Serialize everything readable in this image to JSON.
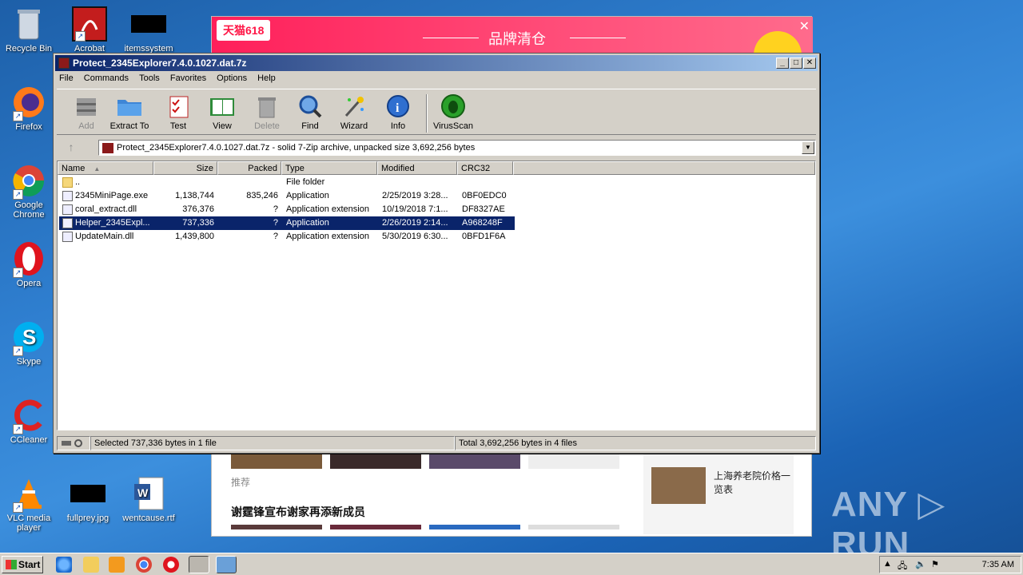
{
  "desktop": {
    "icons": [
      {
        "label": "Recycle Bin"
      },
      {
        "label": "Acrobat"
      },
      {
        "label": "itemssystem"
      },
      {
        "label": "Firefox"
      },
      {
        "label": "Google Chrome"
      },
      {
        "label": "Opera"
      },
      {
        "label": "Skype"
      },
      {
        "label": "CCleaner"
      },
      {
        "label": "VLC media player"
      },
      {
        "label": "fullprey.jpg"
      },
      {
        "label": "wentcause.rtf"
      }
    ]
  },
  "background_browser": {
    "banner_tag": "天猫618",
    "banner_title": "品牌清仓",
    "section_label": "推荐",
    "headline": "谢霆锋宣布谢家再添新成员",
    "side_news": "上海养老院价格一览表"
  },
  "window": {
    "title": "Protect_2345Explorer7.4.0.1027.dat.7z",
    "controls": {
      "minimize": "_",
      "maximize": "□",
      "close": "✕"
    },
    "menu": [
      "File",
      "Commands",
      "Tools",
      "Favorites",
      "Options",
      "Help"
    ],
    "toolbar": [
      {
        "label": "Add",
        "icon": "add-icon",
        "enabled": false
      },
      {
        "label": "Extract To",
        "icon": "folder-icon",
        "enabled": true
      },
      {
        "label": "Test",
        "icon": "checklist-icon",
        "enabled": true
      },
      {
        "label": "View",
        "icon": "book-icon",
        "enabled": true
      },
      {
        "label": "Delete",
        "icon": "trash-icon",
        "enabled": false
      },
      {
        "label": "Find",
        "icon": "magnifier-icon",
        "enabled": true
      },
      {
        "label": "Wizard",
        "icon": "wand-icon",
        "enabled": true
      },
      {
        "label": "Info",
        "icon": "info-icon",
        "enabled": true
      },
      {
        "label": "VirusScan",
        "icon": "bug-icon",
        "enabled": true
      }
    ],
    "address": "Protect_2345Explorer7.4.0.1027.dat.7z - solid 7-Zip archive, unpacked size 3,692,256 bytes",
    "columns": [
      "Name",
      "Size",
      "Packed",
      "Type",
      "Modified",
      "CRC32"
    ],
    "rows": [
      {
        "name": "..",
        "size": "",
        "packed": "",
        "type": "File folder",
        "modified": "",
        "crc": "",
        "selected": false
      },
      {
        "name": "2345MiniPage.exe",
        "size": "1,138,744",
        "packed": "835,246",
        "type": "Application",
        "modified": "2/25/2019 3:28...",
        "crc": "0BF0EDC0",
        "selected": false
      },
      {
        "name": "coral_extract.dll",
        "size": "376,376",
        "packed": "?",
        "type": "Application extension",
        "modified": "10/19/2018 7:1...",
        "crc": "DF8327AE",
        "selected": false
      },
      {
        "name": "Helper_2345Expl...",
        "size": "737,336",
        "packed": "?",
        "type": "Application",
        "modified": "2/26/2019 2:14...",
        "crc": "A968248F",
        "selected": true
      },
      {
        "name": "UpdateMain.dll",
        "size": "1,439,800",
        "packed": "?",
        "type": "Application extension",
        "modified": "5/30/2019 6:30...",
        "crc": "0BFD1F6A",
        "selected": false
      }
    ],
    "status_left": "Selected 737,336 bytes in 1 file",
    "status_right": "Total 3,692,256 bytes in 4 files"
  },
  "taskbar": {
    "start_label": "Start",
    "clock": "7:35 AM"
  },
  "watermark": "ANY ▷ RUN"
}
